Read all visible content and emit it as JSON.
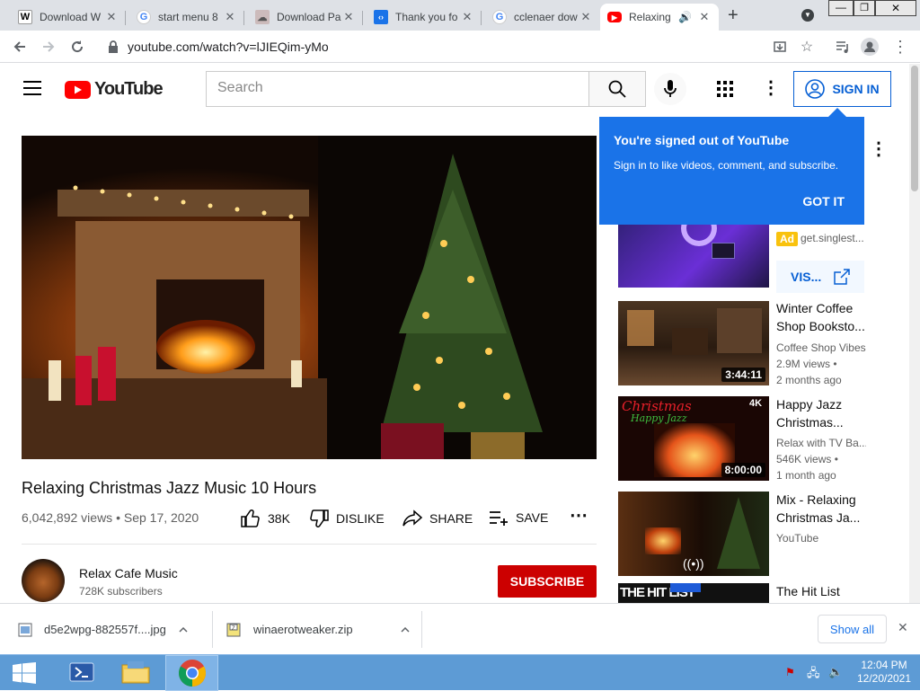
{
  "tabs": [
    {
      "label": "Download W",
      "favicon": "word-icon"
    },
    {
      "label": "start menu 8",
      "favicon": "google-icon"
    },
    {
      "label": "Download Pa",
      "favicon": "download-page-icon"
    },
    {
      "label": "Thank you fo",
      "favicon": "thankyou-icon"
    },
    {
      "label": "cclenaer dow",
      "favicon": "google-icon"
    },
    {
      "label": "Relaxing",
      "favicon": "youtube-icon"
    }
  ],
  "address": {
    "url": "youtube.com/watch?v=lJIEQim-yMo"
  },
  "youtube": {
    "logo_text": "YouTube",
    "search_placeholder": "Search",
    "sign_in_label": "SIGN IN"
  },
  "popup": {
    "title": "You're signed out of YouTube",
    "body": "Sign in to like videos, comment, and subscribe.",
    "button": "GOT IT"
  },
  "video": {
    "title": "Relaxing Christmas Jazz Music 10 Hours",
    "meta": "6,042,892 views • Sep 17, 2020",
    "likes": "38K",
    "dislike_label": "DISLIKE",
    "share_label": "SHARE",
    "save_label": "SAVE",
    "channel_name": "Relax Cafe Music",
    "subscribers": "728K subscribers",
    "subscribe_label": "SUBSCRIBE"
  },
  "ad": {
    "badge": "Ad",
    "domain": "get.singlest...",
    "visit_label": "VIS..."
  },
  "recommendations": [
    {
      "title": "Winter Coffee Shop Booksto...",
      "channel": "Coffee Shop Vibes",
      "views": "2.9M views •",
      "age": "2 months ago",
      "duration": "3:44:11"
    },
    {
      "title": "Happy Jazz Christmas...",
      "channel": "Relax with TV Ba...",
      "views": "546K views •",
      "age": "1 month ago",
      "duration": "8:00:00",
      "badge": "4K",
      "thumb_text_1": "Christmas",
      "thumb_text_2": "Happy Jazz"
    },
    {
      "title": "Mix - Relaxing Christmas Ja...",
      "channel": "YouTube"
    },
    {
      "title": "The Hit List",
      "thumb_text": "THE HIT LIST"
    }
  ],
  "downloads": {
    "items": [
      {
        "name": "d5e2wpg-882557f....jpg"
      },
      {
        "name": "winaerotweaker.zip"
      }
    ],
    "show_all": "Show all"
  },
  "taskbar": {
    "time": "12:04 PM",
    "date": "12/20/2021"
  }
}
